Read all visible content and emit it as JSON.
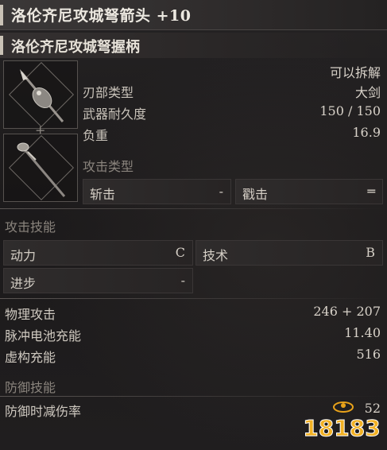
{
  "header": {
    "title": "洛伦齐尼攻城弩箭头 +10",
    "subtitle": "洛伦齐尼攻城弩握柄"
  },
  "weapon": {
    "note": "可以拆解",
    "stats": [
      {
        "label": "刃部类型",
        "value": "大剑"
      },
      {
        "label": "武器耐久度",
        "value": "150 / 150"
      },
      {
        "label": "负重",
        "value": "16.9"
      }
    ]
  },
  "attack_type": {
    "header": "攻击类型",
    "cells": [
      {
        "label": "斩击",
        "value": "-"
      },
      {
        "label": "戳击",
        "value": "═"
      }
    ]
  },
  "attack_skill": {
    "header": "攻击技能",
    "cells": [
      {
        "label": "动力",
        "value": "C"
      },
      {
        "label": "技术",
        "value": "B"
      },
      {
        "label": "进步",
        "value": "-"
      }
    ]
  },
  "attack_stats": [
    {
      "label": "物理攻击",
      "value": "246 + 207"
    },
    {
      "label": "脉冲电池充能",
      "value": "11.40"
    },
    {
      "label": "虚构充能",
      "value": "516"
    }
  ],
  "defense_skill": {
    "header": "防御技能",
    "rows": [
      {
        "label": "防御时减伤率",
        "value": "52"
      }
    ]
  },
  "watermark": {
    "text": "18183"
  },
  "colors": {
    "accent_bar": "#c9c2b6",
    "watermark_orange": "#e8a21a"
  }
}
